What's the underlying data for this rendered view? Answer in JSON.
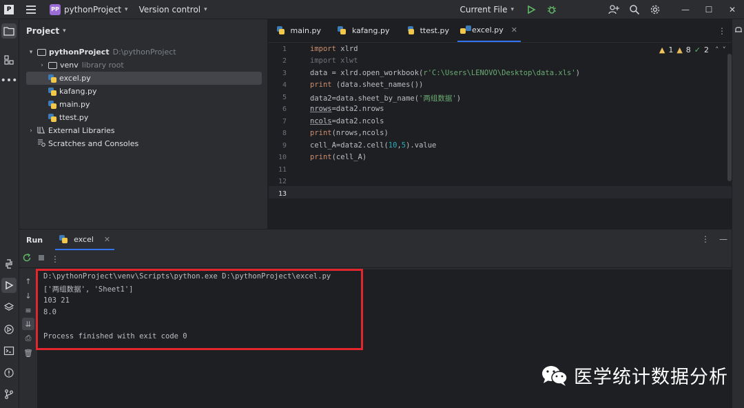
{
  "titlebar": {
    "project_badge": "PP",
    "project_name": "pythonProject",
    "vcs_label": "Version control",
    "run_config": "Current File",
    "logo_text": "P"
  },
  "project_panel": {
    "header": "Project",
    "root_name": "pythonProject",
    "root_path": "D:\\pythonProject",
    "venv_name": "venv",
    "venv_note": "library root",
    "files": [
      "excel.py",
      "kafang.py",
      "main.py",
      "ttest.py"
    ],
    "external_libraries": "External Libraries",
    "scratches": "Scratches and Consoles"
  },
  "editor": {
    "tabs": [
      {
        "label": "main.py"
      },
      {
        "label": "kafang.py"
      },
      {
        "label": "ttest.py"
      },
      {
        "label": "excel.py"
      }
    ],
    "active_tab": "excel.py",
    "inspections": {
      "warnings": "1",
      "weak_warnings": "8",
      "ok": "2"
    },
    "line_numbers": [
      "1",
      "2",
      "3",
      "4",
      "5",
      "6",
      "7",
      "8",
      "9",
      "10",
      "11",
      "12",
      "13"
    ],
    "current_line": "13",
    "code": {
      "l1_kw": "import",
      "l1_rest": " xlrd",
      "l2": "import xlwt",
      "l3_a": "data = xlrd.open_workbook(",
      "l3_str": "r'C:\\Users\\LENOVO\\Desktop\\data.xls'",
      "l3_b": ")",
      "l4_kw": "print",
      "l4_rest": " (data.sheet_names())",
      "l5_a": "data2=data.sheet_by_name(",
      "l5_str": "'两组数据'",
      "l5_b": ")",
      "l6_u": "nrows",
      "l6_rest": "=data2.nrows",
      "l7_u": "ncols",
      "l7_rest": "=data2.ncols",
      "l8_kw": "print",
      "l8_rest": "(nrows,ncols)",
      "l9_a": "cell_A=data2.cell(",
      "l9_n1": "10",
      "l9_c": ",",
      "l9_n2": "5",
      "l9_b": ").value",
      "l10_kw": "print",
      "l10_rest": "(cell_A)"
    }
  },
  "run_panel": {
    "title": "Run",
    "tab_label": "excel",
    "console_lines": [
      "D:\\pythonProject\\venv\\Scripts\\python.exe D:\\pythonProject\\excel.py",
      "['两组数据', 'Sheet1']",
      "103 21",
      "8.0",
      "",
      "Process finished with exit code 0"
    ]
  },
  "watermark": {
    "text": "医学统计数据分析",
    "icon": "wechat-icon"
  },
  "colors": {
    "accent": "#3574f0",
    "highlight_box": "#e3262d",
    "run_green": "#5fb865"
  }
}
